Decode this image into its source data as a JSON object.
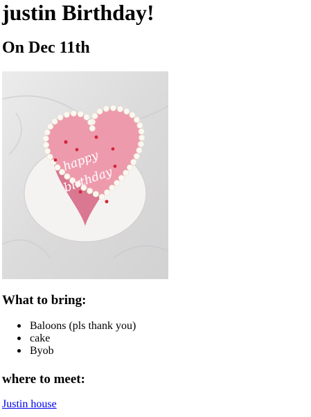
{
  "page": {
    "title": "justin Birthday!",
    "date": "On Dec 11th"
  },
  "image": {
    "subject": "pink heart-shaped birthday cake",
    "cake_text_line1": "happy",
    "cake_text_line2": "birthday"
  },
  "bring": {
    "heading": "What to bring:",
    "items": [
      "Baloons (pls thank you)",
      "cake",
      "Byob"
    ]
  },
  "meet": {
    "heading": "where to meet:",
    "link_text": "Justin house"
  },
  "colors": {
    "link": "#0000ee",
    "cake_pink": "#e98fa3",
    "frosting_border": "#faf6ee",
    "sprinkle_red": "#d1283c",
    "cloth": "#e2e1e1"
  }
}
